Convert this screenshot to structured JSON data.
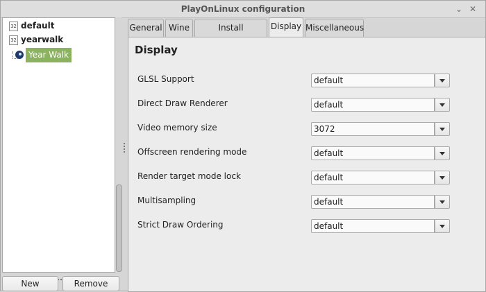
{
  "window": {
    "title": "PlayOnLinux configuration",
    "minimize_glyph": "⌄",
    "close_glyph": "✕"
  },
  "tree": {
    "nodes": [
      {
        "icon_text": "32",
        "label": "default"
      },
      {
        "icon_text": "32",
        "label": "yearwalk"
      }
    ],
    "selected_child": {
      "label": "Year Walk",
      "icon": "steam-icon",
      "highlight": "#8bb25f"
    }
  },
  "buttons": {
    "new": "New",
    "remove": "Remove"
  },
  "tabs": [
    "General",
    "Wine",
    "Install components",
    "Display",
    "Miscellaneous"
  ],
  "active_tab": "Display",
  "display": {
    "title": "Display",
    "settings": [
      {
        "label": "GLSL Support",
        "value": "default"
      },
      {
        "label": "Direct Draw Renderer",
        "value": "default"
      },
      {
        "label": "Video memory size",
        "value": "3072"
      },
      {
        "label": "Offscreen rendering mode",
        "value": "default"
      },
      {
        "label": "Render target mode lock",
        "value": "default"
      },
      {
        "label": "Multisampling",
        "value": "default"
      },
      {
        "label": "Strict Draw Ordering",
        "value": "default"
      }
    ]
  }
}
